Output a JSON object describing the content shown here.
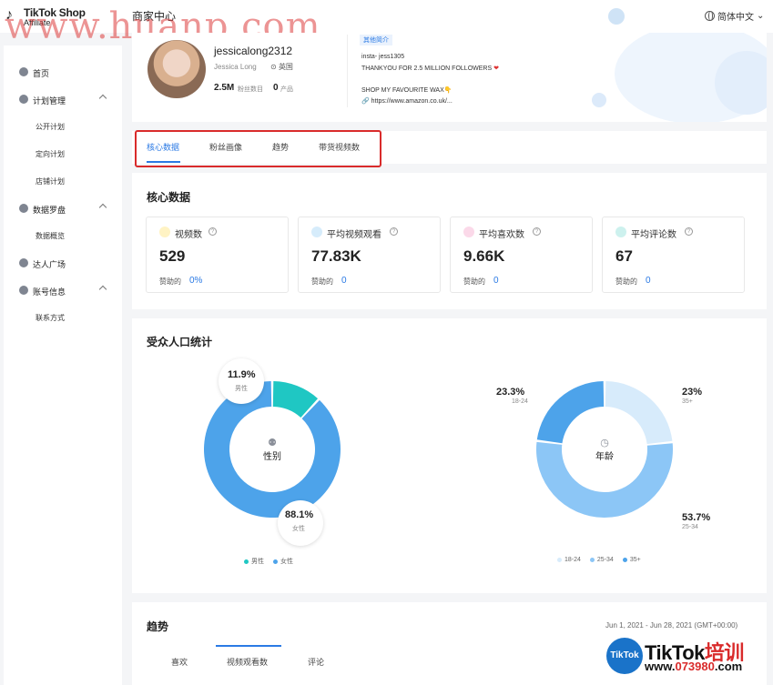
{
  "header": {
    "logo_text": "TikTok Shop",
    "logo_sub": "Affiliate",
    "brand": "商家中心",
    "language": "简体中文",
    "watermark": "www.huanp.com"
  },
  "sidebar": {
    "items": [
      {
        "label": "首页"
      },
      {
        "label": "计划管理",
        "children": [
          "公开计划",
          "定向计划",
          "店铺计划"
        ]
      },
      {
        "label": "数据罗盘",
        "children": [
          "数据概览"
        ]
      },
      {
        "label": "达人广场"
      },
      {
        "label": "账号信息",
        "children": [
          "联系方式"
        ]
      }
    ]
  },
  "profile": {
    "username": "jessicalong2312",
    "realname": "Jessica Long",
    "location": "英国",
    "fans_value": "2.5M",
    "fans_label": "粉丝数目",
    "products_value": "0",
    "products_label": "产品",
    "info_tag": "其他简介",
    "bio": [
      "insta- jess1305",
      "THANKYOU FOR 2.5 MILLION FOLLOWERS",
      "SHOP MY FAVOURITE WAX👇",
      "https://www.amazon.co.uk/..."
    ]
  },
  "tabs": [
    "核心数据",
    "粉丝画像",
    "趋势",
    "带货视频数"
  ],
  "core": {
    "title": "核心数据",
    "stats": [
      {
        "label": "视频数",
        "value": "529",
        "sub_label": "赞助的",
        "sub_value": "0%"
      },
      {
        "label": "平均视频观看",
        "value": "77.83K",
        "sub_label": "赞助的",
        "sub_value": "0"
      },
      {
        "label": "平均喜欢数",
        "value": "9.66K",
        "sub_label": "赞助的",
        "sub_value": "0"
      },
      {
        "label": "平均评论数",
        "value": "67",
        "sub_label": "赞助的",
        "sub_value": "0"
      }
    ]
  },
  "demographics": {
    "title": "受众人口统计",
    "gender": {
      "center_label": "性别",
      "segments": [
        {
          "name": "男性",
          "pct": "11.9%",
          "value": 11.9,
          "color": "#1fc7c3"
        },
        {
          "name": "女性",
          "pct": "88.1%",
          "value": 88.1,
          "color": "#4da3ea"
        }
      ]
    },
    "age": {
      "center_label": "年龄",
      "segments": [
        {
          "name": "18-24",
          "pct": "23.3%",
          "value": 23.3,
          "color": "#d7ebfb"
        },
        {
          "name": "25-34",
          "pct": "53.7%",
          "value": 53.7,
          "color": "#8cc6f6"
        },
        {
          "name": "35+",
          "pct": "23%",
          "value": 23.0,
          "color": "#4da3ea"
        }
      ]
    }
  },
  "trend": {
    "title": "趋势",
    "range": "Jun 1, 2021 - Jun 28, 2021 (GMT+00:00)",
    "tabs": [
      "喜欢",
      "视频观看数",
      "评论"
    ]
  },
  "corner_logo": {
    "circle": "TikTok",
    "brand_a": "TikTok",
    "brand_b": "培训",
    "url_a": "www.",
    "url_b": "073980",
    "url_c": ".com"
  }
}
